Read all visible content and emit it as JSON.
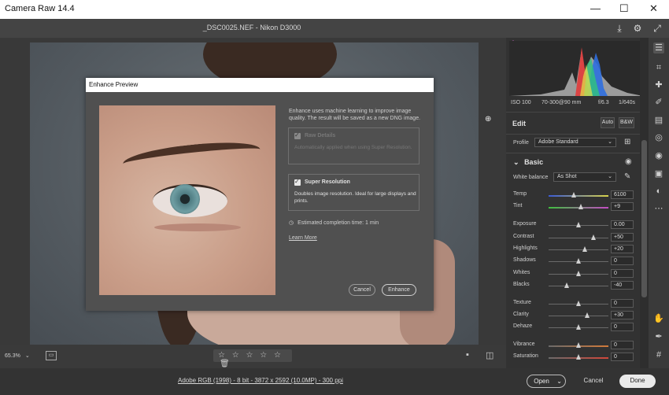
{
  "app": {
    "title": "Camera Raw 14.4"
  },
  "window_controls": {
    "minimize": "—",
    "maximize": "☐",
    "close": "✕"
  },
  "document": {
    "title": "_DSC0025.NEF  -  Nikon D3000"
  },
  "dialog": {
    "title": "Enhance Preview",
    "description": "Enhance uses machine learning to improve image quality. The result will be saved as a new DNG image.",
    "options": [
      {
        "label": "Raw Details",
        "desc": "Automatically applied when using Super Resolution.",
        "checked": true,
        "enabled": false
      },
      {
        "label": "Super Resolution",
        "desc": "Doubles image resolution. Ideal for large displays and prints.",
        "checked": true,
        "enabled": true
      }
    ],
    "estimate": "Estimated completion time: 1 min",
    "learn_more": "Learn More",
    "cancel": "Cancel",
    "enhance": "Enhance"
  },
  "exif": {
    "iso": "ISO 100",
    "lens": "70-300@90 mm",
    "aperture": "f/6.3",
    "shutter": "1/640s"
  },
  "edit": {
    "header": "Edit",
    "auto": "Auto",
    "bw": "B&W",
    "profile_label": "Profile",
    "profile_value": "Adobe Standard",
    "basic_header": "Basic",
    "wb_label": "White balance",
    "wb_value": "As Shot",
    "sliders": [
      {
        "label": "Temp",
        "value": "6100",
        "pos": 0.42
      },
      {
        "label": "Tint",
        "value": "+9",
        "pos": 0.54
      },
      {
        "label": "Exposure",
        "value": "0.00",
        "pos": 0.5
      },
      {
        "label": "Contrast",
        "value": "+50",
        "pos": 0.75
      },
      {
        "label": "Highlights",
        "value": "+20",
        "pos": 0.6
      },
      {
        "label": "Shadows",
        "value": "0",
        "pos": 0.5
      },
      {
        "label": "Whites",
        "value": "0",
        "pos": 0.5
      },
      {
        "label": "Blacks",
        "value": "-40",
        "pos": 0.3
      },
      {
        "label": "Texture",
        "value": "0",
        "pos": 0.5
      },
      {
        "label": "Clarity",
        "value": "+30",
        "pos": 0.65
      },
      {
        "label": "Dehaze",
        "value": "0",
        "pos": 0.5
      },
      {
        "label": "Vibrance",
        "value": "0",
        "pos": 0.5
      },
      {
        "label": "Saturation",
        "value": "0",
        "pos": 0.5
      }
    ]
  },
  "bottom": {
    "zoom": "65.3%",
    "stars": "☆ ☆ ☆ ☆ ☆",
    "workflow": "Adobe RGB (1998) - 8 bit - 3872 x 2592 (10.0MP) - 300 ppi",
    "open": "Open",
    "cancel": "Cancel",
    "done": "Done"
  },
  "colors": {
    "accent": "#ffffff",
    "panel": "#323232",
    "canvas": "#393939"
  }
}
